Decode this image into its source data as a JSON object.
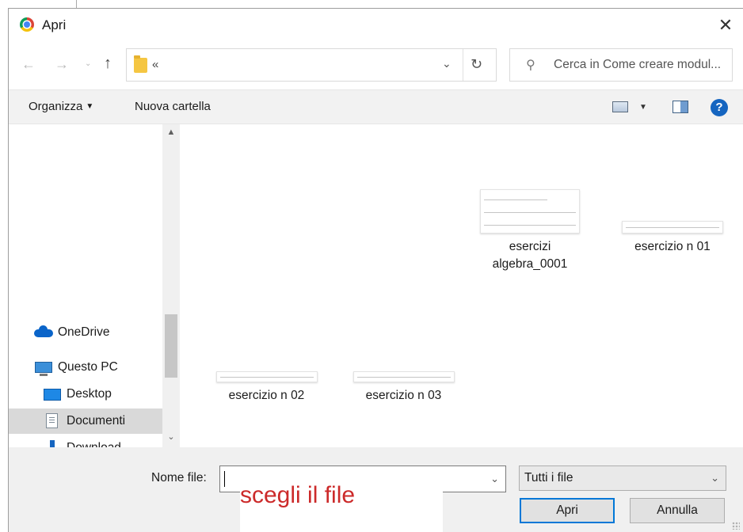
{
  "window": {
    "title": "Apri",
    "close_glyph": "✕"
  },
  "navigation": {
    "back_glyph": "←",
    "forward_glyph": "→",
    "recent_glyph": "⌄",
    "up_glyph": "↑",
    "address_text": "«",
    "address_dropdown_glyph": "⌄",
    "refresh_glyph": "↻",
    "search_placeholder": "Cerca in Come creare modul...",
    "search_glyph": "⚲"
  },
  "commandbar": {
    "organize_label": "Organizza",
    "new_folder_label": "Nuova cartella",
    "caret_glyph": "▼",
    "help_glyph": "?"
  },
  "sidebar": {
    "scroll_up_glyph": "▲",
    "scroll_down_glyph": "⌄",
    "items": [
      {
        "label": "OneDrive",
        "icon": "cloud-icon"
      },
      {
        "label": "Questo PC",
        "icon": "computer-icon"
      },
      {
        "label": "Desktop",
        "icon": "desktop-icon"
      },
      {
        "label": "Documenti",
        "icon": "documents-icon",
        "selected": true
      },
      {
        "label": "Download",
        "icon": "download-icon"
      }
    ]
  },
  "files": [
    {
      "name_line1": "esercizi",
      "name_line2": "algebra_0001"
    },
    {
      "name_line1": "esercizio n 01",
      "name_line2": ""
    },
    {
      "name_line1": "esercizio n 02",
      "name_line2": ""
    },
    {
      "name_line1": "esercizio n 03",
      "name_line2": ""
    }
  ],
  "bottom": {
    "filename_label": "Nome file:",
    "filename_value": "",
    "dropdown_glyph": "⌄",
    "filetype_value": "Tutti i file",
    "open_button": "Apri",
    "cancel_button": "Annulla",
    "annotation": "scegli il file"
  },
  "colors": {
    "accent": "#0078d7",
    "annotation": "#cc2a2a",
    "help": "#1565c0",
    "selected_bg": "#d9d9d9"
  }
}
